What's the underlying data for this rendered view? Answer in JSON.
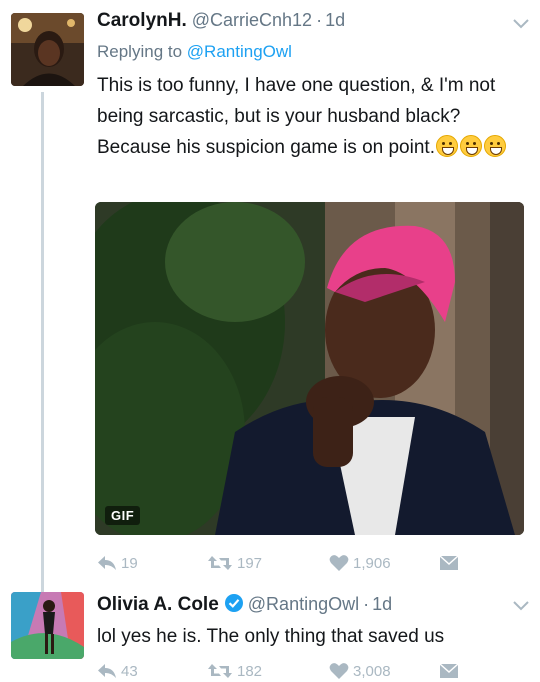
{
  "tweets": [
    {
      "display_name": "CarolynH.",
      "handle": "@CarrieCnh12",
      "separator": "·",
      "time": "1d",
      "replying_to_prefix": "Replying to",
      "replying_to_handle": "@RantingOwl",
      "text": "This is too funny, I have one question, & I'm not being sarcastic, but is your husband black? Because his suspicion game is on point.",
      "emoji_names": [
        "grinning-face",
        "grinning-face",
        "grinning-face"
      ],
      "media_badge": "GIF",
      "replies": "19",
      "retweets": "197",
      "likes": "1,906"
    },
    {
      "display_name": "Olivia A. Cole",
      "verified": true,
      "handle": "@RantingOwl",
      "separator": "·",
      "time": "1d",
      "text": "lol yes he is. The only thing that saved us",
      "replies": "43",
      "retweets": "182",
      "likes": "3,008"
    }
  ],
  "colors": {
    "link_blue": "#1da1f2",
    "secondary_gray": "#657786",
    "action_gray": "#aab8c2",
    "thread_line": "#ccd6dd",
    "verified_blue": "#1da1f2"
  },
  "icons": [
    "reply-icon",
    "retweet-icon",
    "like-heart-icon",
    "direct-message-icon",
    "chevron-down-icon",
    "verified-badge-icon"
  ]
}
